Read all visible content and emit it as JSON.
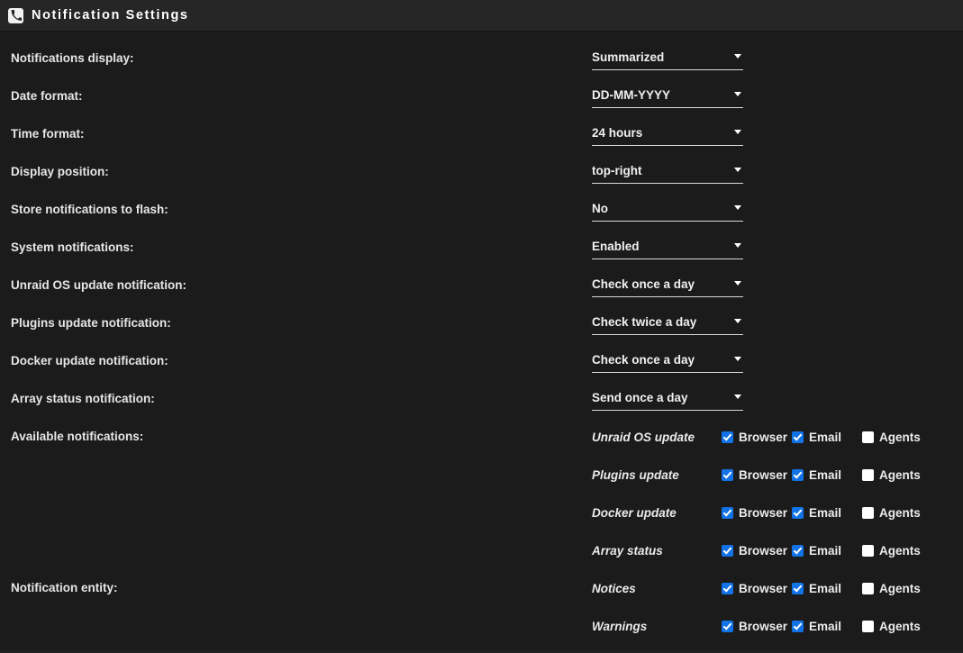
{
  "window": {
    "title": "Notification Settings",
    "icon": "phone-icon"
  },
  "colors": {
    "background": "#1b1b1b",
    "titlebar": "#262626",
    "text": "#e8e8e8",
    "checkbox_checked": "#1273e6",
    "checkbox_unchecked": "#ffffff",
    "underline": "#d9d9d9"
  },
  "settings": [
    {
      "label": "Notifications display:",
      "value": "Summarized",
      "name": "notifications-display"
    },
    {
      "label": "Date format:",
      "value": "DD-MM-YYYY",
      "name": "date-format"
    },
    {
      "label": "Time format:",
      "value": "24 hours",
      "name": "time-format"
    },
    {
      "label": "Display position:",
      "value": "top-right",
      "name": "display-position"
    },
    {
      "label": "Store notifications to flash:",
      "value": "No",
      "name": "store-notifications-to-flash"
    },
    {
      "label": "System notifications:",
      "value": "Enabled",
      "name": "system-notifications"
    },
    {
      "label": "Unraid OS update notification:",
      "value": "Check once a day",
      "name": "unraid-os-update-notification"
    },
    {
      "label": "Plugins update notification:",
      "value": "Check twice a day",
      "name": "plugins-update-notification"
    },
    {
      "label": "Docker update notification:",
      "value": "Check once a day",
      "name": "docker-update-notification"
    },
    {
      "label": "Array status notification:",
      "value": "Send once a day",
      "name": "array-status-notification"
    }
  ],
  "available_notifications": {
    "label": "Available notifications:",
    "channel_labels": {
      "browser": "Browser",
      "email": "Email",
      "agents": "Agents"
    },
    "rows": [
      {
        "name": "Unraid OS update",
        "browser": true,
        "email": true,
        "agents": false
      },
      {
        "name": "Plugins update",
        "browser": true,
        "email": true,
        "agents": false
      },
      {
        "name": "Docker update",
        "browser": true,
        "email": true,
        "agents": false
      },
      {
        "name": "Array status",
        "browser": true,
        "email": true,
        "agents": false
      }
    ]
  },
  "notification_entity": {
    "label": "Notification entity:",
    "rows": [
      {
        "name": "Notices",
        "browser": true,
        "email": true,
        "agents": false
      },
      {
        "name": "Warnings",
        "browser": true,
        "email": true,
        "agents": false
      }
    ]
  }
}
